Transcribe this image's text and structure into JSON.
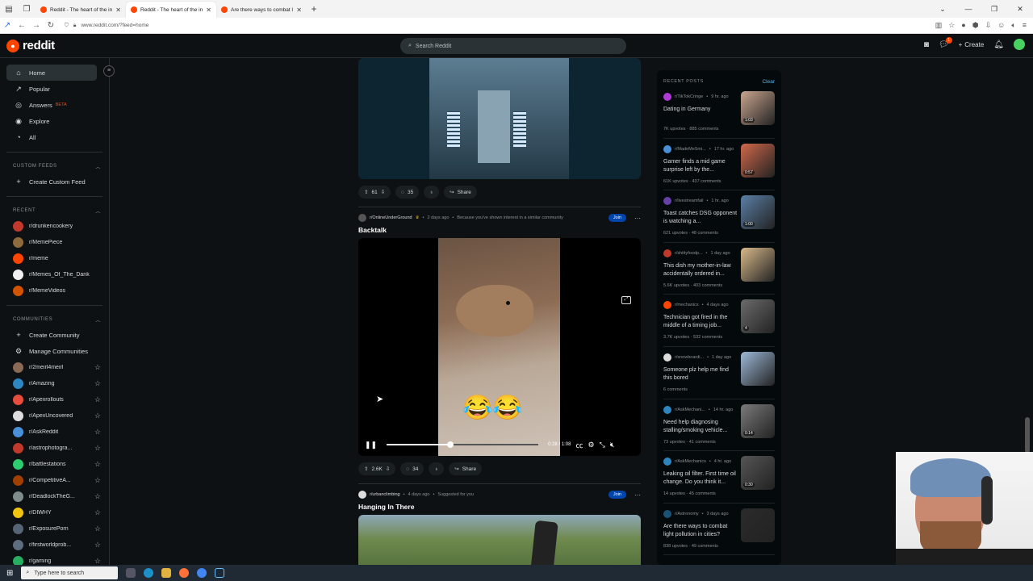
{
  "browser": {
    "tabs": [
      {
        "title": "Reddit - The heart of the intern",
        "active": false
      },
      {
        "title": "Reddit - The heart of the intern",
        "active": true
      },
      {
        "title": "Are there ways to combat light",
        "active": false
      }
    ],
    "url": "www.reddit.com/?feed=home"
  },
  "header": {
    "logo_text": "reddit",
    "search_placeholder": "Search Reddit",
    "create_label": "Create",
    "notification_count": "1"
  },
  "sidebar": {
    "nav": [
      {
        "label": "Home",
        "icon": "home-icon",
        "glyph": "⌂",
        "active": true
      },
      {
        "label": "Popular",
        "icon": "popular-icon",
        "glyph": "↗",
        "active": false
      },
      {
        "label": "Answers",
        "icon": "answers-icon",
        "glyph": "◎",
        "active": false,
        "badge": "BETA"
      },
      {
        "label": "Explore",
        "icon": "explore-icon",
        "glyph": "◉",
        "active": false
      },
      {
        "label": "All",
        "icon": "all-icon",
        "glyph": "◔",
        "active": false
      }
    ],
    "custom_feeds_header": "CUSTOM FEEDS",
    "create_custom_feed": "Create Custom Feed",
    "recent_header": "RECENT",
    "recent": [
      {
        "name": "r/drunkencookery",
        "color": "#c0392b"
      },
      {
        "name": "r/MemePiece",
        "color": "#8e6b3c"
      },
      {
        "name": "r/meme",
        "color": "#ff4500"
      },
      {
        "name": "r/Memes_Of_The_Dank",
        "color": "#f0f0f0"
      },
      {
        "name": "r/MemeVideos",
        "color": "#d35400"
      }
    ],
    "communities_header": "COMMUNITIES",
    "create_community": "Create Community",
    "manage_communities": "Manage Communities",
    "communities": [
      {
        "name": "r/2meirl4meirl",
        "color": "#8b6a55"
      },
      {
        "name": "r/Amazing",
        "color": "#2e86c1"
      },
      {
        "name": "r/Apexrollouts",
        "color": "#e74c3c"
      },
      {
        "name": "r/ApexUncovered",
        "color": "#dddddd"
      },
      {
        "name": "r/AskReddit",
        "color": "#4a90d9"
      },
      {
        "name": "r/astrophotogra...",
        "color": "#c0392b"
      },
      {
        "name": "r/battlestations",
        "color": "#2ecc71"
      },
      {
        "name": "r/CompetitiveA...",
        "color": "#a04000"
      },
      {
        "name": "r/DeadlockTheG...",
        "color": "#7f8c8d"
      },
      {
        "name": "r/DIWHY",
        "color": "#f1c40f"
      },
      {
        "name": "r/ExposurePorn",
        "color": "#566573"
      },
      {
        "name": "r/firstworldprob...",
        "color": "#5d6d7e"
      },
      {
        "name": "r/gaming",
        "color": "#27ae60"
      }
    ]
  },
  "feed": {
    "post1": {
      "upvotes": "61",
      "comments": "35",
      "share_label": "Share"
    },
    "post2": {
      "subreddit": "r/OnlineUnderGround",
      "age": "2 days ago",
      "reason": "Because you've shown interest in a similar community",
      "join_label": "Join",
      "title": "Backtalk",
      "video_time": "0:28 / 1:08",
      "progress": 0.42,
      "emoji": "😂😂",
      "upvotes": "2.6K",
      "comments": "34",
      "share_label": "Share"
    },
    "post3": {
      "subreddit": "r/urbanclimbing",
      "age": "4 days ago",
      "reason": "Suggested for you",
      "join_label": "Join",
      "title": "Hanging In There"
    }
  },
  "recent_posts": {
    "header": "RECENT POSTS",
    "clear_label": "Clear",
    "items": [
      {
        "sub": "r/TikTokCringe",
        "age": "9 hr. ago",
        "title": "Dating in Germany",
        "stats": "7K upvotes · 885 comments",
        "duration": "1:03",
        "color": "#c9a58f",
        "avcolor": "#b03ad6"
      },
      {
        "sub": "r/MadeMeSmi...",
        "age": "17 hr. ago",
        "title": "Gamer finds a mid game surprise left by the...",
        "stats": "61K upvotes · 437 comments",
        "duration": "0:57",
        "color": "#d0684a",
        "avcolor": "#4a90d9"
      },
      {
        "sub": "r/livestreamfail",
        "age": "1 hr. ago",
        "title": "Toast catches DSG opponent is watching a...",
        "stats": "621 upvotes · 48 comments",
        "duration": "1:00",
        "color": "#5b7fa6",
        "avcolor": "#6441a5"
      },
      {
        "sub": "r/shittyfoodp...",
        "age": "1 day ago",
        "title": "This dish my mother-in-law accidentally ordered in...",
        "stats": "5.6K upvotes · 403 comments",
        "duration": "",
        "color": "#d8b98a",
        "avcolor": "#c0392b"
      },
      {
        "sub": "r/mechanics",
        "age": "4 days ago",
        "title": "Technician got fired in the middle of a timing job...",
        "stats": "3.7K upvotes · 532 comments",
        "duration": "4",
        "color": "#6b6b6b",
        "avcolor": "#ff4500"
      },
      {
        "sub": "r/snowboardi...",
        "age": "1 day ago",
        "title": "Someone plz help me find this bored",
        "stats": "6 comments",
        "duration": "",
        "color": "#9db8d8",
        "avcolor": "#dddddd"
      },
      {
        "sub": "r/AskMechani...",
        "age": "14 hr. ago",
        "title": "Need help diagnosing stalling/smoking vehicle...",
        "stats": "73 upvotes · 41 comments",
        "duration": "0:14",
        "color": "#7a7a7a",
        "avcolor": "#2e86c1"
      },
      {
        "sub": "r/AskMechanics",
        "age": "4 hr. ago",
        "title": "Leaking oil filter. First time oil change. Do you think it...",
        "stats": "14 upvotes · 45 comments",
        "duration": "0:30",
        "color": "#555555",
        "avcolor": "#2e86c1"
      },
      {
        "sub": "r/Astronomy",
        "age": "3 days ago",
        "title": "Are there ways to combat light pollution in cities?",
        "stats": "838 upvotes · 49 comments",
        "duration": "",
        "color": "#2b2b2b",
        "avcolor": "#1a5276"
      }
    ]
  },
  "taskbar": {
    "search_placeholder": "Type here to search"
  }
}
